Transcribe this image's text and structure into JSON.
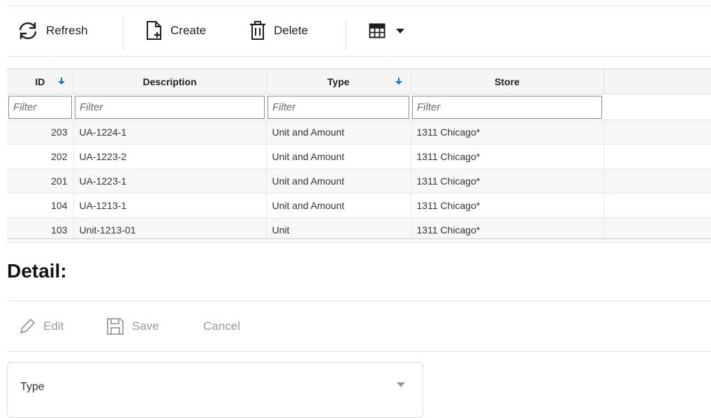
{
  "toolbar": {
    "refresh_label": "Refresh",
    "create_label": "Create",
    "delete_label": "Delete",
    "view_menu_icon": "table-grid-icon"
  },
  "grid": {
    "columns": [
      {
        "label": "ID",
        "sort": "descending",
        "sort_rank": "2"
      },
      {
        "label": "Description",
        "sort": "none"
      },
      {
        "label": "Type",
        "sort": "descending",
        "sort_rank": "1"
      },
      {
        "label": "Store",
        "sort": "none"
      }
    ],
    "filter_placeholder": "Filter",
    "rows": [
      {
        "id": "203",
        "description": "UA-1224-1",
        "type": "Unit and Amount",
        "store": "1311 Chicago*"
      },
      {
        "id": "202",
        "description": "UA-1223-2",
        "type": "Unit and Amount",
        "store": "1311 Chicago*"
      },
      {
        "id": "201",
        "description": "UA-1223-1",
        "type": "Unit and Amount",
        "store": "1311 Chicago*"
      },
      {
        "id": "104",
        "description": "UA-1213-1",
        "type": "Unit and Amount",
        "store": "1311 Chicago*"
      },
      {
        "id": "103",
        "description": "Unit-1213-01",
        "type": "Unit",
        "store": "1311 Chicago*"
      }
    ]
  },
  "detail": {
    "title": "Detail:",
    "edit_label": "Edit",
    "save_label": "Save",
    "cancel_label": "Cancel",
    "type_field_label": "Type"
  },
  "colors": {
    "sort_arrow": "#1a73c8",
    "disabled_text": "#9a9a9a"
  }
}
